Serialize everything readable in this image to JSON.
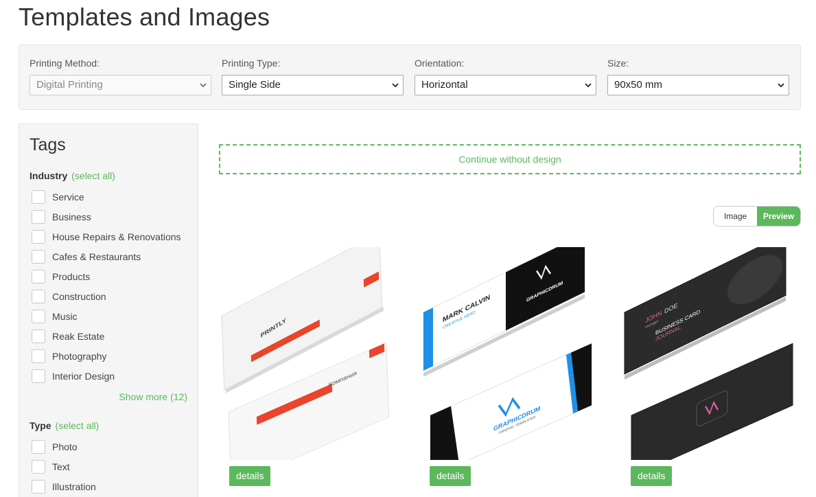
{
  "page": {
    "title": "Templates and Images"
  },
  "filters": {
    "method": {
      "label": "Printing Method:",
      "value": "Digital Printing"
    },
    "type": {
      "label": "Printing Type:",
      "value": "Single Side"
    },
    "orientation": {
      "label": "Orientation:",
      "value": "Horizontal"
    },
    "size": {
      "label": "Size:",
      "value": "90x50 mm"
    }
  },
  "sidebar": {
    "title": "Tags",
    "industry": {
      "label": "Industry",
      "select_all": "(select all)",
      "items": [
        "Service",
        "Business",
        "House Repairs & Renovations",
        "Cafes & Restaurants",
        "Products",
        "Construction",
        "Music",
        "Reak Estate",
        "Photography",
        "Interior Design"
      ],
      "show_more": "Show more (12)"
    },
    "type": {
      "label": "Type",
      "select_all": "(select all)",
      "items": [
        "Photo",
        "Text",
        "Illustration"
      ]
    }
  },
  "main": {
    "continue_label": "Continue without design",
    "view_toggle": {
      "image": "Image",
      "preview": "Preview",
      "active": "Preview"
    },
    "cards": [
      {
        "details": "details",
        "front_text": "PRINTLY",
        "back_text": "Компания",
        "accent": "#e8452c"
      },
      {
        "details": "details",
        "name": "MARK CALVIN",
        "role": "CREATIVE HEAD",
        "brand": "GRAPHICDRUM",
        "brand_sub": "GRAPHIC TEMPLATES",
        "accent": "#1e90e8"
      },
      {
        "details": "details",
        "name_first": "JOHN",
        "name_last": "DOE",
        "role": "manager",
        "title1": "BUSINESS CARD",
        "title2": "JOURNAL",
        "accent": "#e060a8"
      }
    ]
  },
  "colors": {
    "accent_green": "#5cb85c",
    "panel_bg": "#f5f5f5"
  }
}
